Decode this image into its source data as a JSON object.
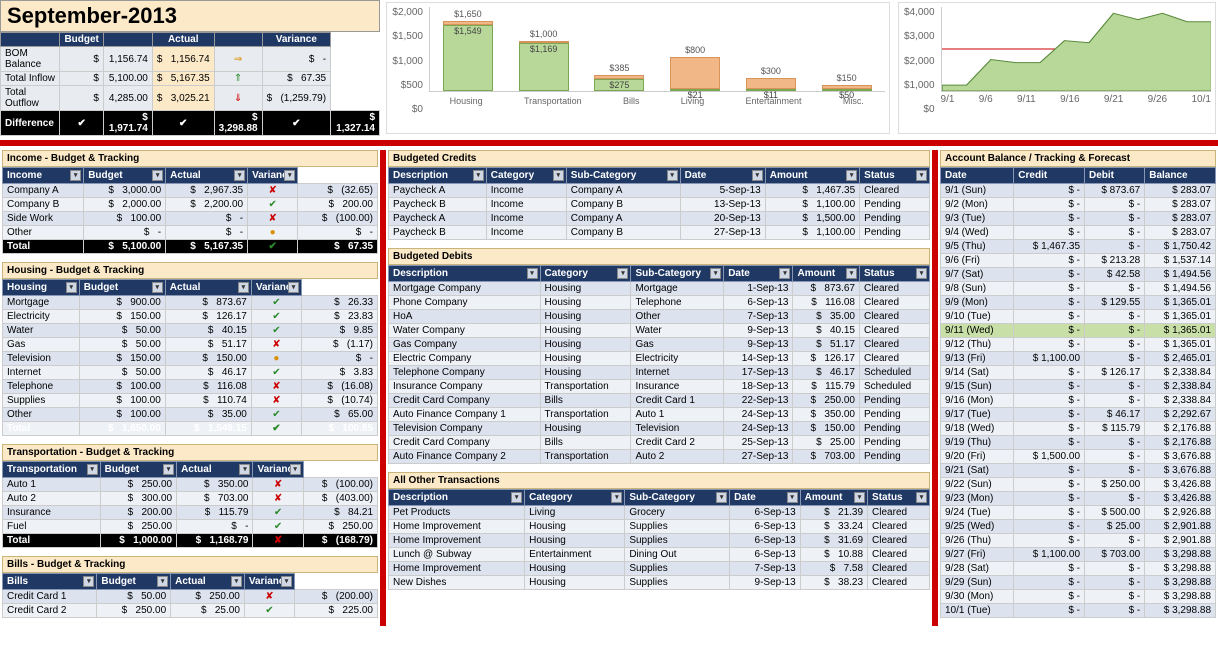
{
  "title": "September-2013",
  "summary": {
    "headers": [
      "",
      "Budget",
      "",
      "Actual",
      "",
      "Variance"
    ],
    "rows": [
      {
        "label": "BOM Balance",
        "b": "1,156.74",
        "a": "1,156.74",
        "ai": "⇒",
        "v": "-",
        "vi": ""
      },
      {
        "label": "Total Inflow",
        "b": "5,100.00",
        "a": "5,167.35",
        "ai": "⇑",
        "v": "67.35",
        "vi": ""
      },
      {
        "label": "Total Outflow",
        "b": "4,285.00",
        "a": "3,025.21",
        "ai": "⇓",
        "v": "(1,259.79)",
        "vi": ""
      }
    ],
    "diff": {
      "label": "Difference",
      "b": "1,971.74",
      "a": "3,298.88",
      "v": "1,327.14"
    }
  },
  "chart_data": [
    {
      "type": "bar",
      "ylim": [
        0,
        2000
      ],
      "yticks": [
        "$2,000",
        "$1,500",
        "$1,000",
        "$500",
        "$0"
      ],
      "categories": [
        "Housing",
        "Transportation",
        "Bills",
        "Living",
        "Entertainment",
        "Misc."
      ],
      "series": [
        {
          "name": "Budget",
          "values": [
            1650,
            1000,
            385,
            800,
            300,
            150
          ]
        },
        {
          "name": "Actual",
          "values": [
            1549,
            1169,
            275,
            21,
            11,
            50
          ]
        }
      ],
      "top_labels": [
        "$1,650",
        "$1,000",
        "$385",
        "$800",
        "$300",
        "$150"
      ],
      "in_labels": [
        "$1,549",
        "$1,169",
        "$275",
        "$21",
        "$11",
        "$50"
      ]
    },
    {
      "type": "area",
      "ylim": [
        0,
        4000
      ],
      "yticks": [
        "$4,000",
        "$3,000",
        "$2,000",
        "$1,000",
        "$0"
      ],
      "x": [
        "9/1",
        "9/6",
        "9/11",
        "9/16",
        "9/21",
        "9/26",
        "10/1"
      ],
      "values": [
        280,
        280,
        1500,
        1350,
        1350,
        2400,
        2300,
        3700,
        3400,
        3700,
        3300,
        3300
      ]
    }
  ],
  "income": {
    "title": "Income - Budget & Tracking",
    "headers": [
      "Income",
      "Budget",
      "Actual",
      "Variance"
    ],
    "rows": [
      {
        "n": "Company A",
        "b": "3,000.00",
        "a": "2,967.35",
        "i": "bad",
        "v": "(32.65)"
      },
      {
        "n": "Company B",
        "b": "2,000.00",
        "a": "2,200.00",
        "i": "ok",
        "v": "200.00"
      },
      {
        "n": "Side Work",
        "b": "100.00",
        "a": "-",
        "i": "bad",
        "v": "(100.00)"
      },
      {
        "n": "Other",
        "b": "-",
        "a": "-",
        "i": "warn",
        "v": "-"
      }
    ],
    "total": {
      "n": "Total",
      "b": "5,100.00",
      "a": "5,167.35",
      "i": "ok",
      "v": "67.35"
    }
  },
  "housing": {
    "title": "Housing - Budget & Tracking",
    "headers": [
      "Housing",
      "Budget",
      "Actual",
      "Variance"
    ],
    "rows": [
      {
        "n": "Mortgage",
        "b": "900.00",
        "a": "873.67",
        "i": "ok",
        "v": "26.33"
      },
      {
        "n": "Electricity",
        "b": "150.00",
        "a": "126.17",
        "i": "ok",
        "v": "23.83"
      },
      {
        "n": "Water",
        "b": "50.00",
        "a": "40.15",
        "i": "ok",
        "v": "9.85"
      },
      {
        "n": "Gas",
        "b": "50.00",
        "a": "51.17",
        "i": "bad",
        "v": "(1.17)"
      },
      {
        "n": "Television",
        "b": "150.00",
        "a": "150.00",
        "i": "warn",
        "v": "-"
      },
      {
        "n": "Internet",
        "b": "50.00",
        "a": "46.17",
        "i": "ok",
        "v": "3.83"
      },
      {
        "n": "Telephone",
        "b": "100.00",
        "a": "116.08",
        "i": "bad",
        "v": "(16.08)"
      },
      {
        "n": "Supplies",
        "b": "100.00",
        "a": "110.74",
        "i": "bad",
        "v": "(10.74)"
      },
      {
        "n": "Other",
        "b": "100.00",
        "a": "35.00",
        "i": "ok",
        "v": "65.00"
      }
    ],
    "total": {
      "n": "Total",
      "b": "1,650.00",
      "a": "1,549.15",
      "i": "ok",
      "v": "100.85"
    }
  },
  "transport": {
    "title": "Transportation - Budget & Tracking",
    "headers": [
      "Transportation",
      "Budget",
      "Actual",
      "Variance"
    ],
    "rows": [
      {
        "n": "Auto 1",
        "b": "250.00",
        "a": "350.00",
        "i": "bad",
        "v": "(100.00)"
      },
      {
        "n": "Auto 2",
        "b": "300.00",
        "a": "703.00",
        "i": "bad",
        "v": "(403.00)"
      },
      {
        "n": "Insurance",
        "b": "200.00",
        "a": "115.79",
        "i": "ok",
        "v": "84.21"
      },
      {
        "n": "Fuel",
        "b": "250.00",
        "a": "-",
        "i": "ok",
        "v": "250.00"
      }
    ],
    "total": {
      "n": "Total",
      "b": "1,000.00",
      "a": "1,168.79",
      "i": "bad",
      "v": "(168.79)"
    }
  },
  "bills": {
    "title": "Bills - Budget & Tracking",
    "headers": [
      "Bills",
      "Budget",
      "Actual",
      "Variance"
    ],
    "rows": [
      {
        "n": "Credit Card 1",
        "b": "50.00",
        "a": "250.00",
        "i": "bad",
        "v": "(200.00)"
      },
      {
        "n": "Credit Card 2",
        "b": "250.00",
        "a": "25.00",
        "i": "ok",
        "v": "225.00"
      }
    ]
  },
  "credits": {
    "title": "Budgeted Credits",
    "headers": [
      "Description",
      "Category",
      "Sub-Category",
      "Date",
      "Amount",
      "Status"
    ],
    "rows": [
      {
        "d": "Paycheck A",
        "c": "Income",
        "s": "Company A",
        "dt": "5-Sep-13",
        "a": "1,467.35",
        "st": "Cleared"
      },
      {
        "d": "Paycheck B",
        "c": "Income",
        "s": "Company B",
        "dt": "13-Sep-13",
        "a": "1,100.00",
        "st": "Pending"
      },
      {
        "d": "Paycheck A",
        "c": "Income",
        "s": "Company A",
        "dt": "20-Sep-13",
        "a": "1,500.00",
        "st": "Pending"
      },
      {
        "d": "Paycheck B",
        "c": "Income",
        "s": "Company B",
        "dt": "27-Sep-13",
        "a": "1,100.00",
        "st": "Pending"
      }
    ]
  },
  "debits": {
    "title": "Budgeted Debits",
    "headers": [
      "Description",
      "Category",
      "Sub-Category",
      "Date",
      "Amount",
      "Status"
    ],
    "rows": [
      {
        "d": "Mortgage Company",
        "c": "Housing",
        "s": "Mortgage",
        "dt": "1-Sep-13",
        "a": "873.67",
        "st": "Cleared"
      },
      {
        "d": "Phone Company",
        "c": "Housing",
        "s": "Telephone",
        "dt": "6-Sep-13",
        "a": "116.08",
        "st": "Cleared"
      },
      {
        "d": "HoA",
        "c": "Housing",
        "s": "Other",
        "dt": "7-Sep-13",
        "a": "35.00",
        "st": "Cleared"
      },
      {
        "d": "Water Company",
        "c": "Housing",
        "s": "Water",
        "dt": "9-Sep-13",
        "a": "40.15",
        "st": "Cleared"
      },
      {
        "d": "Gas Company",
        "c": "Housing",
        "s": "Gas",
        "dt": "9-Sep-13",
        "a": "51.17",
        "st": "Cleared"
      },
      {
        "d": "Electric Company",
        "c": "Housing",
        "s": "Electricity",
        "dt": "14-Sep-13",
        "a": "126.17",
        "st": "Cleared"
      },
      {
        "d": "Telephone Company",
        "c": "Housing",
        "s": "Internet",
        "dt": "17-Sep-13",
        "a": "46.17",
        "st": "Scheduled"
      },
      {
        "d": "Insurance Company",
        "c": "Transportation",
        "s": "Insurance",
        "dt": "18-Sep-13",
        "a": "115.79",
        "st": "Scheduled"
      },
      {
        "d": "Credit Card Company",
        "c": "Bills",
        "s": "Credit Card 1",
        "dt": "22-Sep-13",
        "a": "250.00",
        "st": "Pending"
      },
      {
        "d": "Auto Finance Company 1",
        "c": "Transportation",
        "s": "Auto 1",
        "dt": "24-Sep-13",
        "a": "350.00",
        "st": "Pending"
      },
      {
        "d": "Television Company",
        "c": "Housing",
        "s": "Television",
        "dt": "24-Sep-13",
        "a": "150.00",
        "st": "Pending"
      },
      {
        "d": "Credit Card Company",
        "c": "Bills",
        "s": "Credit Card 2",
        "dt": "25-Sep-13",
        "a": "25.00",
        "st": "Pending"
      },
      {
        "d": "Auto Finance Company 2",
        "c": "Transportation",
        "s": "Auto 2",
        "dt": "27-Sep-13",
        "a": "703.00",
        "st": "Pending"
      }
    ]
  },
  "other": {
    "title": "All Other Transactions",
    "headers": [
      "Description",
      "Category",
      "Sub-Category",
      "Date",
      "Amount",
      "Status"
    ],
    "rows": [
      {
        "d": "Pet Products",
        "c": "Living",
        "s": "Grocery",
        "dt": "6-Sep-13",
        "a": "21.39",
        "st": "Cleared"
      },
      {
        "d": "Home Improvement",
        "c": "Housing",
        "s": "Supplies",
        "dt": "6-Sep-13",
        "a": "33.24",
        "st": "Cleared"
      },
      {
        "d": "Home Improvement",
        "c": "Housing",
        "s": "Supplies",
        "dt": "6-Sep-13",
        "a": "31.69",
        "st": "Cleared"
      },
      {
        "d": "Lunch @ Subway",
        "c": "Entertainment",
        "s": "Dining Out",
        "dt": "6-Sep-13",
        "a": "10.88",
        "st": "Cleared"
      },
      {
        "d": "Home Improvement",
        "c": "Housing",
        "s": "Supplies",
        "dt": "7-Sep-13",
        "a": "7.58",
        "st": "Cleared"
      },
      {
        "d": "New Dishes",
        "c": "Housing",
        "s": "Supplies",
        "dt": "9-Sep-13",
        "a": "38.23",
        "st": "Cleared"
      }
    ]
  },
  "balance": {
    "title": "Account Balance / Tracking & Forecast",
    "headers": [
      "Date",
      "Credit",
      "Debit",
      "Balance"
    ],
    "rows": [
      {
        "d": "9/1 (Sun)",
        "c": "-",
        "db": "873.67",
        "b": "283.07"
      },
      {
        "d": "9/2 (Mon)",
        "c": "-",
        "db": "-",
        "b": "283.07"
      },
      {
        "d": "9/3 (Tue)",
        "c": "-",
        "db": "-",
        "b": "283.07"
      },
      {
        "d": "9/4 (Wed)",
        "c": "-",
        "db": "-",
        "b": "283.07"
      },
      {
        "d": "9/5 (Thu)",
        "c": "1,467.35",
        "db": "-",
        "b": "1,750.42"
      },
      {
        "d": "9/6 (Fri)",
        "c": "-",
        "db": "213.28",
        "b": "1,537.14"
      },
      {
        "d": "9/7 (Sat)",
        "c": "-",
        "db": "42.58",
        "b": "1,494.56"
      },
      {
        "d": "9/8 (Sun)",
        "c": "-",
        "db": "-",
        "b": "1,494.56"
      },
      {
        "d": "9/9 (Mon)",
        "c": "-",
        "db": "129.55",
        "b": "1,365.01"
      },
      {
        "d": "9/10 (Tue)",
        "c": "-",
        "db": "-",
        "b": "1,365.01"
      },
      {
        "d": "9/11 (Wed)",
        "c": "-",
        "db": "-",
        "b": "1,365.01",
        "hl": true
      },
      {
        "d": "9/12 (Thu)",
        "c": "-",
        "db": "-",
        "b": "1,365.01"
      },
      {
        "d": "9/13 (Fri)",
        "c": "1,100.00",
        "db": "-",
        "b": "2,465.01"
      },
      {
        "d": "9/14 (Sat)",
        "c": "-",
        "db": "126.17",
        "b": "2,338.84"
      },
      {
        "d": "9/15 (Sun)",
        "c": "-",
        "db": "-",
        "b": "2,338.84"
      },
      {
        "d": "9/16 (Mon)",
        "c": "-",
        "db": "-",
        "b": "2,338.84"
      },
      {
        "d": "9/17 (Tue)",
        "c": "-",
        "db": "46.17",
        "b": "2,292.67"
      },
      {
        "d": "9/18 (Wed)",
        "c": "-",
        "db": "115.79",
        "b": "2,176.88"
      },
      {
        "d": "9/19 (Thu)",
        "c": "-",
        "db": "-",
        "b": "2,176.88"
      },
      {
        "d": "9/20 (Fri)",
        "c": "1,500.00",
        "db": "-",
        "b": "3,676.88"
      },
      {
        "d": "9/21 (Sat)",
        "c": "-",
        "db": "-",
        "b": "3,676.88"
      },
      {
        "d": "9/22 (Sun)",
        "c": "-",
        "db": "250.00",
        "b": "3,426.88"
      },
      {
        "d": "9/23 (Mon)",
        "c": "-",
        "db": "-",
        "b": "3,426.88"
      },
      {
        "d": "9/24 (Tue)",
        "c": "-",
        "db": "500.00",
        "b": "2,926.88"
      },
      {
        "d": "9/25 (Wed)",
        "c": "-",
        "db": "25.00",
        "b": "2,901.88"
      },
      {
        "d": "9/26 (Thu)",
        "c": "-",
        "db": "-",
        "b": "2,901.88"
      },
      {
        "d": "9/27 (Fri)",
        "c": "1,100.00",
        "db": "703.00",
        "b": "3,298.88"
      },
      {
        "d": "9/28 (Sat)",
        "c": "-",
        "db": "-",
        "b": "3,298.88"
      },
      {
        "d": "9/29 (Sun)",
        "c": "-",
        "db": "-",
        "b": "3,298.88"
      },
      {
        "d": "9/30 (Mon)",
        "c": "-",
        "db": "-",
        "b": "3,298.88"
      },
      {
        "d": "10/1 (Tue)",
        "c": "-",
        "db": "-",
        "b": "3,298.88"
      }
    ]
  }
}
